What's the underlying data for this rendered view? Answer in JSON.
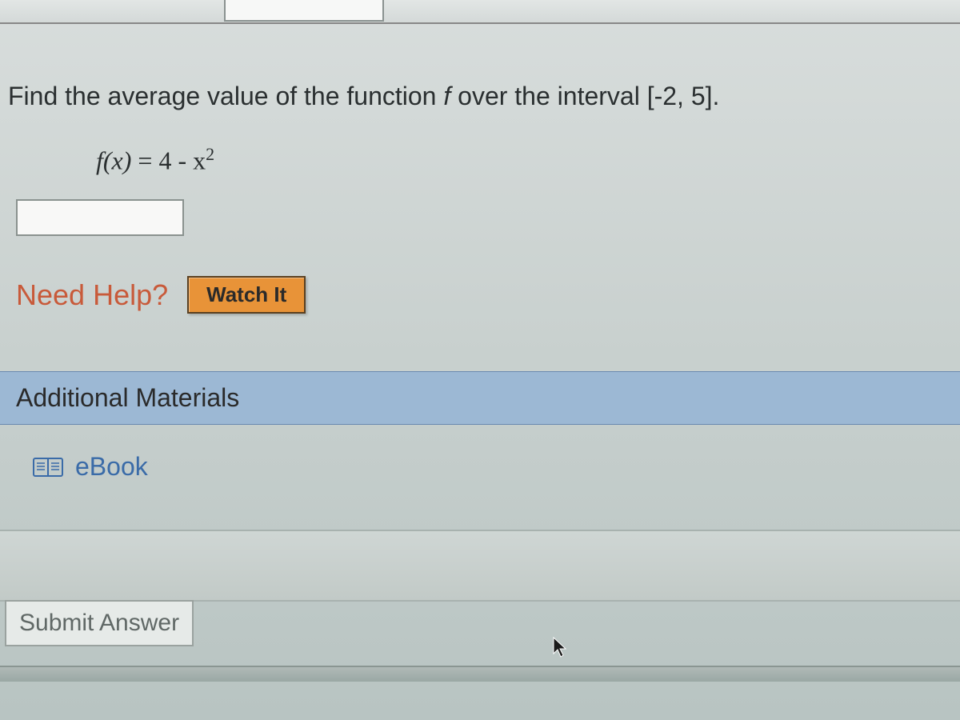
{
  "question": {
    "prompt_prefix": "Find the average value of the function ",
    "function_symbol": "f",
    "prompt_middle": " over the interval ",
    "interval": "[-2, 5]",
    "prompt_suffix": ".",
    "formula_lhs": "f(x)",
    "formula_equals": " = ",
    "formula_rhs_base": "4 - x",
    "formula_rhs_exp": "2"
  },
  "answer_input": {
    "value": ""
  },
  "help": {
    "label": "Need Help?",
    "watch_it": "Watch It"
  },
  "additional_materials": {
    "header": "Additional Materials",
    "ebook_label": "eBook"
  },
  "submit": {
    "label": "Submit Answer"
  }
}
